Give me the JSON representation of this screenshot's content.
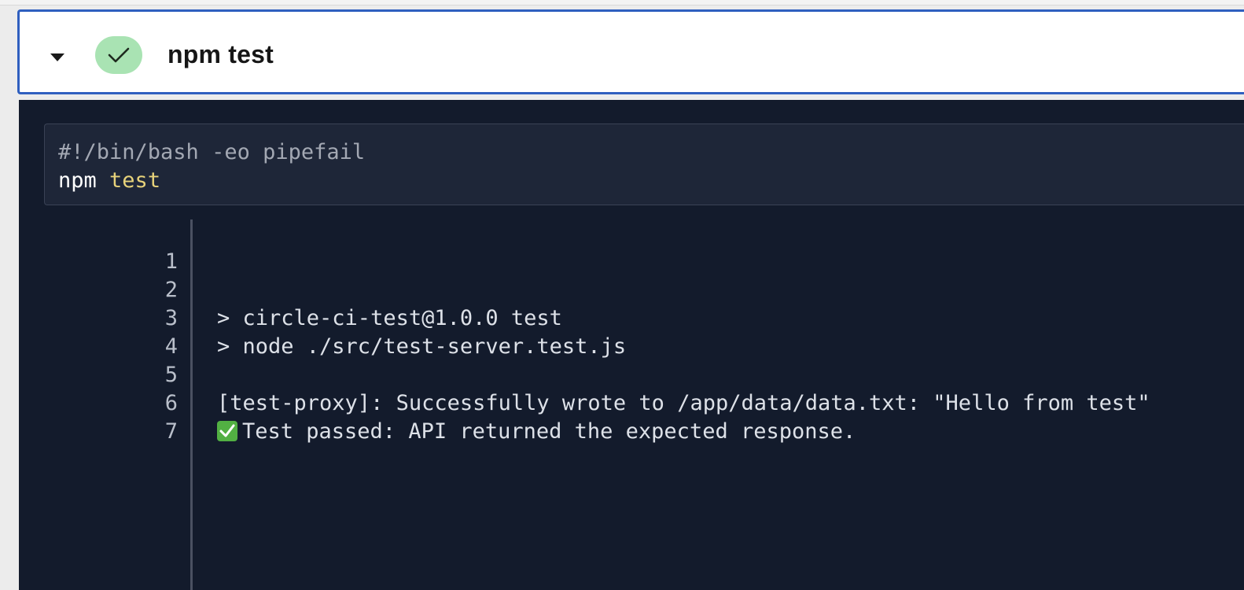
{
  "step": {
    "title": "npm test",
    "status": "success",
    "status_color": "#a9e3b3",
    "header_border_color": "#2f5fbf",
    "icons": {
      "toggle": "caret-down-icon",
      "status": "checkmark-icon"
    }
  },
  "command": {
    "shebang": "#!/bin/bash -eo pipefail",
    "program": "npm",
    "argument": "test"
  },
  "output": {
    "lines": [
      {
        "number": "1",
        "text": ""
      },
      {
        "number": "2",
        "text": "> circle-ci-test@1.0.0 test"
      },
      {
        "number": "3",
        "text": "> node ./src/test-server.test.js"
      },
      {
        "number": "4",
        "text": ""
      },
      {
        "number": "5",
        "text": "[test-proxy]: Successfully wrote to /app/data/data.txt: \"Hello from test\""
      },
      {
        "number": "6",
        "text": "Test passed: API returned the expected response.",
        "icon": "check-mark-button-emoji"
      },
      {
        "number": "7",
        "text": ""
      }
    ]
  }
}
